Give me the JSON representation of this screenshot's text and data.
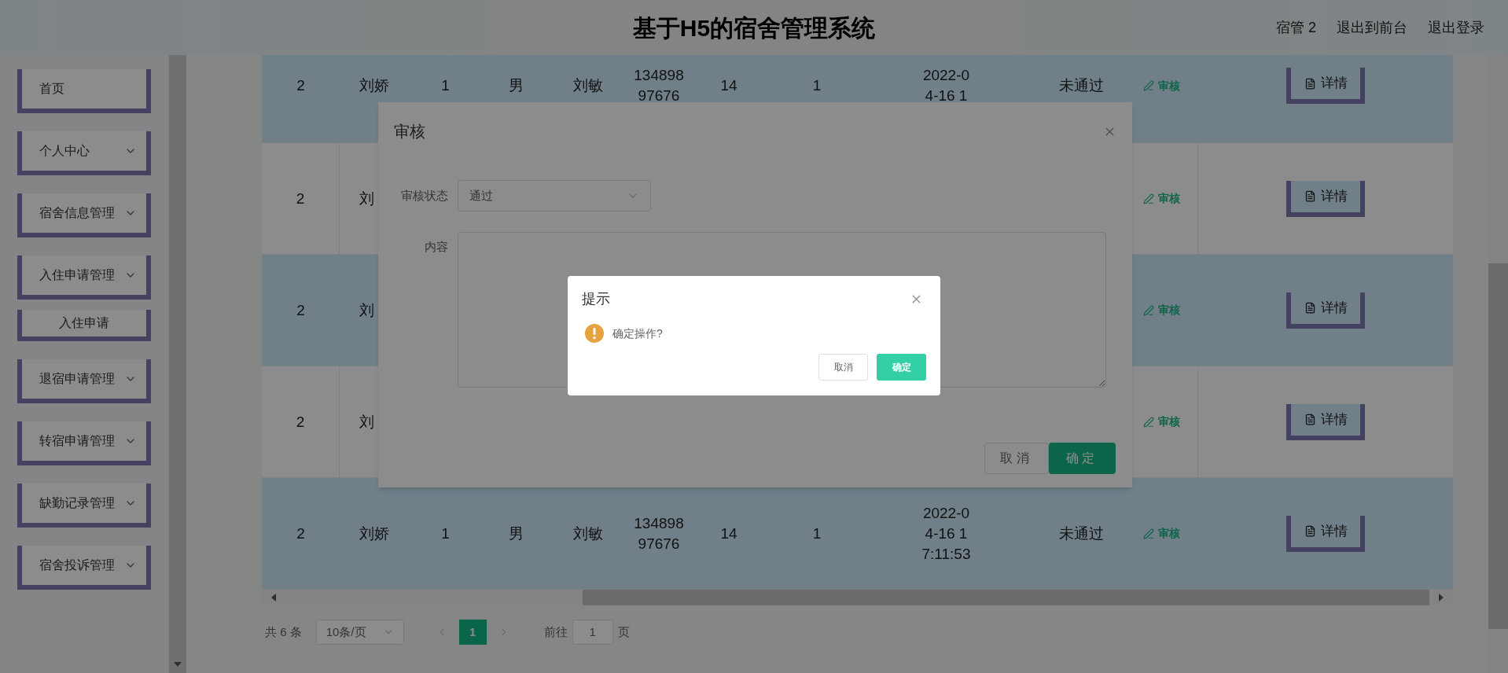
{
  "header": {
    "title": "基于H5的宿舍管理系统",
    "user": "宿管 2",
    "links": [
      "退出到前台",
      "退出登录"
    ]
  },
  "sidebar": {
    "items": [
      {
        "label": "首页",
        "has_submenu": false
      },
      {
        "label": "个人中心",
        "has_submenu": true
      },
      {
        "label": "宿舍信息管理",
        "has_submenu": true
      },
      {
        "label": "入住申请管理",
        "has_submenu": true,
        "children": [
          {
            "label": "入住申请"
          }
        ]
      },
      {
        "label": "退宿申请管理",
        "has_submenu": true
      },
      {
        "label": "转宿申请管理",
        "has_submenu": true
      },
      {
        "label": "缺勤记录管理",
        "has_submenu": true
      },
      {
        "label": "宿舍投诉管理",
        "has_submenu": true
      }
    ]
  },
  "table": {
    "rows": [
      {
        "cells": [
          "2",
          "刘娇",
          "1",
          "男",
          "刘敏",
          "13489897676",
          "14",
          "1",
          "2022-04-16 1",
          "未通过"
        ],
        "action": "审核",
        "button": "详情"
      },
      {
        "cells": [
          "2",
          "刘"
        ],
        "action": "审核",
        "button": "详情"
      },
      {
        "cells": [
          "2",
          "刘"
        ],
        "action": "审核",
        "button": "详情"
      },
      {
        "cells": [
          "2",
          "刘"
        ],
        "action": "审核",
        "button": "详情"
      },
      {
        "cells": [
          "2",
          "刘娇",
          "1",
          "男",
          "刘敏",
          "13489897676",
          "14",
          "1",
          "2022-04-16 17:11:53",
          "未通过"
        ],
        "action": "审核",
        "button": "详情"
      }
    ]
  },
  "pagination": {
    "total": "共 6 条",
    "page_size": "10条/页",
    "pages": [
      {
        "label": "1",
        "selected": true
      }
    ],
    "goto_label": "前往",
    "goto_value": "1",
    "goto_suffix": "页"
  },
  "audit_dialog": {
    "title": "审核",
    "fields": [
      {
        "label": "审核状态",
        "kind": "select",
        "value": "通过"
      },
      {
        "label": "内容",
        "kind": "textarea"
      }
    ],
    "buttons": [
      {
        "label": "取消",
        "kind": "default"
      },
      {
        "label": "确定",
        "kind": "primary"
      }
    ]
  },
  "message_box": {
    "title": "提示",
    "message": "确定操作?",
    "buttons": [
      {
        "label": "取消",
        "kind": "default"
      },
      {
        "label": "确定",
        "kind": "primary"
      }
    ]
  }
}
